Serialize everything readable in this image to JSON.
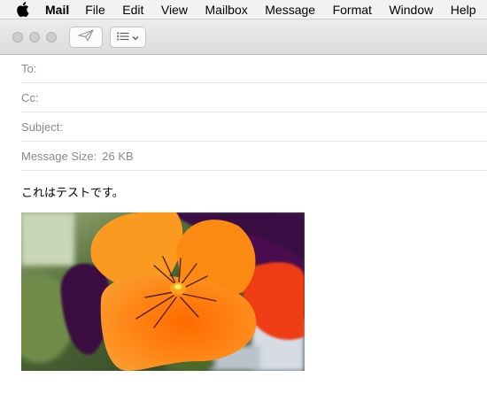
{
  "menubar": {
    "apple_icon": "apple-icon",
    "app_name": "Mail",
    "items": [
      "File",
      "Edit",
      "View",
      "Mailbox",
      "Message",
      "Format",
      "Window",
      "Help"
    ]
  },
  "toolbar": {
    "send_icon": "paper-plane-icon",
    "list_icon": "list-menu-icon"
  },
  "header": {
    "to_label": "To:",
    "cc_label": "Cc:",
    "subject_label": "Subject:",
    "size_label": "Message Size:",
    "size_value": "26 KB"
  },
  "message": {
    "body_text": "これはテストです。",
    "attachment": "image of an orange pansy flower"
  },
  "colors": {
    "menubar_bg": "#f2f2f2",
    "toolbar_bg": "#e4e4e4",
    "label_gray": "#8a8a8a",
    "flower_orange": "#f77d12"
  }
}
